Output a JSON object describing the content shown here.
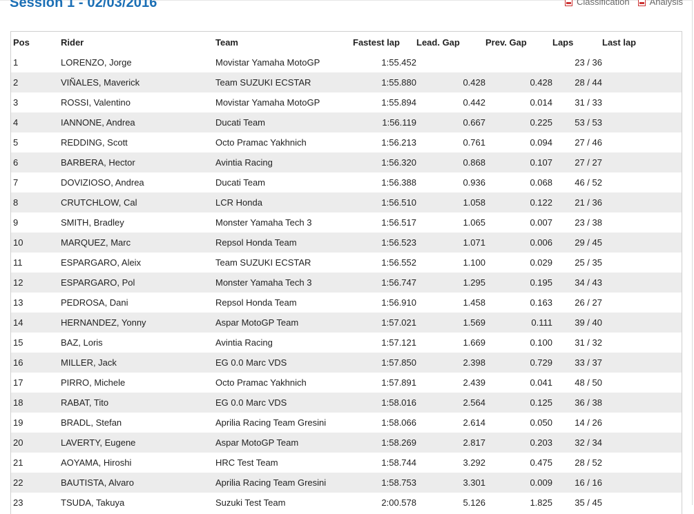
{
  "session": {
    "title": "Session 1 - 02/03/2016"
  },
  "links": {
    "classification": "Classification",
    "analysis": "Analysis"
  },
  "table": {
    "headers": {
      "pos": "Pos",
      "rider": "Rider",
      "team": "Team",
      "fastest_lap": "Fastest lap",
      "lead_gap": "Lead. Gap",
      "prev_gap": "Prev. Gap",
      "laps": "Laps",
      "last_lap": "Last lap"
    },
    "rows": [
      {
        "pos": "1",
        "rider": "LORENZO, Jorge",
        "team": "Movistar Yamaha MotoGP",
        "fastest_lap": "1:55.452",
        "lead_gap": "",
        "prev_gap": "",
        "laps": "23 / 36",
        "last_lap": ""
      },
      {
        "pos": "2",
        "rider": "VIÑALES, Maverick",
        "team": "Team SUZUKI ECSTAR",
        "fastest_lap": "1:55.880",
        "lead_gap": "0.428",
        "prev_gap": "0.428",
        "laps": "28 / 44",
        "last_lap": ""
      },
      {
        "pos": "3",
        "rider": "ROSSI, Valentino",
        "team": "Movistar Yamaha MotoGP",
        "fastest_lap": "1:55.894",
        "lead_gap": "0.442",
        "prev_gap": "0.014",
        "laps": "31 / 33",
        "last_lap": ""
      },
      {
        "pos": "4",
        "rider": "IANNONE, Andrea",
        "team": "Ducati Team",
        "fastest_lap": "1:56.119",
        "lead_gap": "0.667",
        "prev_gap": "0.225",
        "laps": "53 / 53",
        "last_lap": ""
      },
      {
        "pos": "5",
        "rider": "REDDING, Scott",
        "team": "Octo Pramac Yakhnich",
        "fastest_lap": "1:56.213",
        "lead_gap": "0.761",
        "prev_gap": "0.094",
        "laps": "27 / 46",
        "last_lap": ""
      },
      {
        "pos": "6",
        "rider": "BARBERA, Hector",
        "team": "Avintia Racing",
        "fastest_lap": "1:56.320",
        "lead_gap": "0.868",
        "prev_gap": "0.107",
        "laps": "27 / 27",
        "last_lap": ""
      },
      {
        "pos": "7",
        "rider": "DOVIZIOSO, Andrea",
        "team": "Ducati Team",
        "fastest_lap": "1:56.388",
        "lead_gap": "0.936",
        "prev_gap": "0.068",
        "laps": "46 / 52",
        "last_lap": ""
      },
      {
        "pos": "8",
        "rider": "CRUTCHLOW, Cal",
        "team": "LCR Honda",
        "fastest_lap": "1:56.510",
        "lead_gap": "1.058",
        "prev_gap": "0.122",
        "laps": "21 / 36",
        "last_lap": ""
      },
      {
        "pos": "9",
        "rider": "SMITH, Bradley",
        "team": "Monster Yamaha Tech 3",
        "fastest_lap": "1:56.517",
        "lead_gap": "1.065",
        "prev_gap": "0.007",
        "laps": "23 / 38",
        "last_lap": ""
      },
      {
        "pos": "10",
        "rider": "MARQUEZ, Marc",
        "team": "Repsol Honda Team",
        "fastest_lap": "1:56.523",
        "lead_gap": "1.071",
        "prev_gap": "0.006",
        "laps": "29 / 45",
        "last_lap": ""
      },
      {
        "pos": "11",
        "rider": "ESPARGARO, Aleix",
        "team": "Team SUZUKI ECSTAR",
        "fastest_lap": "1:56.552",
        "lead_gap": "1.100",
        "prev_gap": "0.029",
        "laps": "25 / 35",
        "last_lap": ""
      },
      {
        "pos": "12",
        "rider": "ESPARGARO, Pol",
        "team": "Monster Yamaha Tech 3",
        "fastest_lap": "1:56.747",
        "lead_gap": "1.295",
        "prev_gap": "0.195",
        "laps": "34 / 43",
        "last_lap": ""
      },
      {
        "pos": "13",
        "rider": "PEDROSA, Dani",
        "team": "Repsol Honda Team",
        "fastest_lap": "1:56.910",
        "lead_gap": "1.458",
        "prev_gap": "0.163",
        "laps": "26 / 27",
        "last_lap": ""
      },
      {
        "pos": "14",
        "rider": "HERNANDEZ, Yonny",
        "team": "Aspar MotoGP Team",
        "fastest_lap": "1:57.021",
        "lead_gap": "1.569",
        "prev_gap": "0.111",
        "laps": "39 / 40",
        "last_lap": ""
      },
      {
        "pos": "15",
        "rider": "BAZ, Loris",
        "team": "Avintia Racing",
        "fastest_lap": "1:57.121",
        "lead_gap": "1.669",
        "prev_gap": "0.100",
        "laps": "31 / 32",
        "last_lap": ""
      },
      {
        "pos": "16",
        "rider": "MILLER, Jack",
        "team": "EG 0.0 Marc VDS",
        "fastest_lap": "1:57.850",
        "lead_gap": "2.398",
        "prev_gap": "0.729",
        "laps": "33 / 37",
        "last_lap": ""
      },
      {
        "pos": "17",
        "rider": "PIRRO, Michele",
        "team": "Octo Pramac Yakhnich",
        "fastest_lap": "1:57.891",
        "lead_gap": "2.439",
        "prev_gap": "0.041",
        "laps": "48 / 50",
        "last_lap": ""
      },
      {
        "pos": "18",
        "rider": "RABAT, Tito",
        "team": "EG 0.0 Marc VDS",
        "fastest_lap": "1:58.016",
        "lead_gap": "2.564",
        "prev_gap": "0.125",
        "laps": "36 / 38",
        "last_lap": ""
      },
      {
        "pos": "19",
        "rider": "BRADL, Stefan",
        "team": "Aprilia Racing Team Gresini",
        "fastest_lap": "1:58.066",
        "lead_gap": "2.614",
        "prev_gap": "0.050",
        "laps": "14 / 26",
        "last_lap": ""
      },
      {
        "pos": "20",
        "rider": "LAVERTY, Eugene",
        "team": "Aspar MotoGP Team",
        "fastest_lap": "1:58.269",
        "lead_gap": "2.817",
        "prev_gap": "0.203",
        "laps": "32 / 34",
        "last_lap": ""
      },
      {
        "pos": "21",
        "rider": "AOYAMA, Hiroshi",
        "team": "HRC Test Team",
        "fastest_lap": "1:58.744",
        "lead_gap": "3.292",
        "prev_gap": "0.475",
        "laps": "28 / 52",
        "last_lap": ""
      },
      {
        "pos": "22",
        "rider": "BAUTISTA, Alvaro",
        "team": "Aprilia Racing Team Gresini",
        "fastest_lap": "1:58.753",
        "lead_gap": "3.301",
        "prev_gap": "0.009",
        "laps": "16 / 16",
        "last_lap": ""
      },
      {
        "pos": "23",
        "rider": "TSUDA, Takuya",
        "team": "Suzuki Test Team",
        "fastest_lap": "2:00.578",
        "lead_gap": "5.126",
        "prev_gap": "1.825",
        "laps": "35 / 45",
        "last_lap": ""
      }
    ]
  },
  "colors": {
    "title_blue": "#1b6fb5",
    "row_alt": "#ececec",
    "pdf_red": "#cc3333"
  },
  "icons": {
    "classification": "pdf-icon",
    "analysis": "pdf-icon"
  }
}
